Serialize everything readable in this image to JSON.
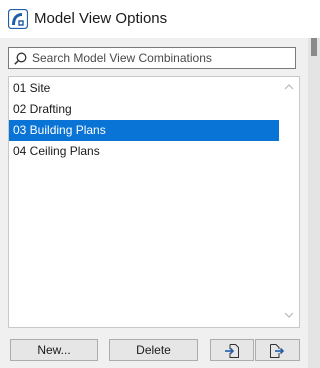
{
  "window": {
    "title": "Model View Options",
    "app_icon": "archicad-logo-icon"
  },
  "search": {
    "placeholder": "Search Model View Combinations",
    "value": "",
    "icon": "search-icon"
  },
  "list": {
    "items": [
      {
        "label": "01 Site",
        "selected": false
      },
      {
        "label": "02 Drafting",
        "selected": false
      },
      {
        "label": "03 Building Plans",
        "selected": true
      },
      {
        "label": "04 Ceiling Plans",
        "selected": false
      }
    ]
  },
  "buttons": {
    "new_label": "New...",
    "delete_label": "Delete",
    "import_icon": "import-icon",
    "export_icon": "export-icon"
  },
  "colors": {
    "selection": "#0a74d6",
    "accent_icon": "#1e5fa8"
  }
}
